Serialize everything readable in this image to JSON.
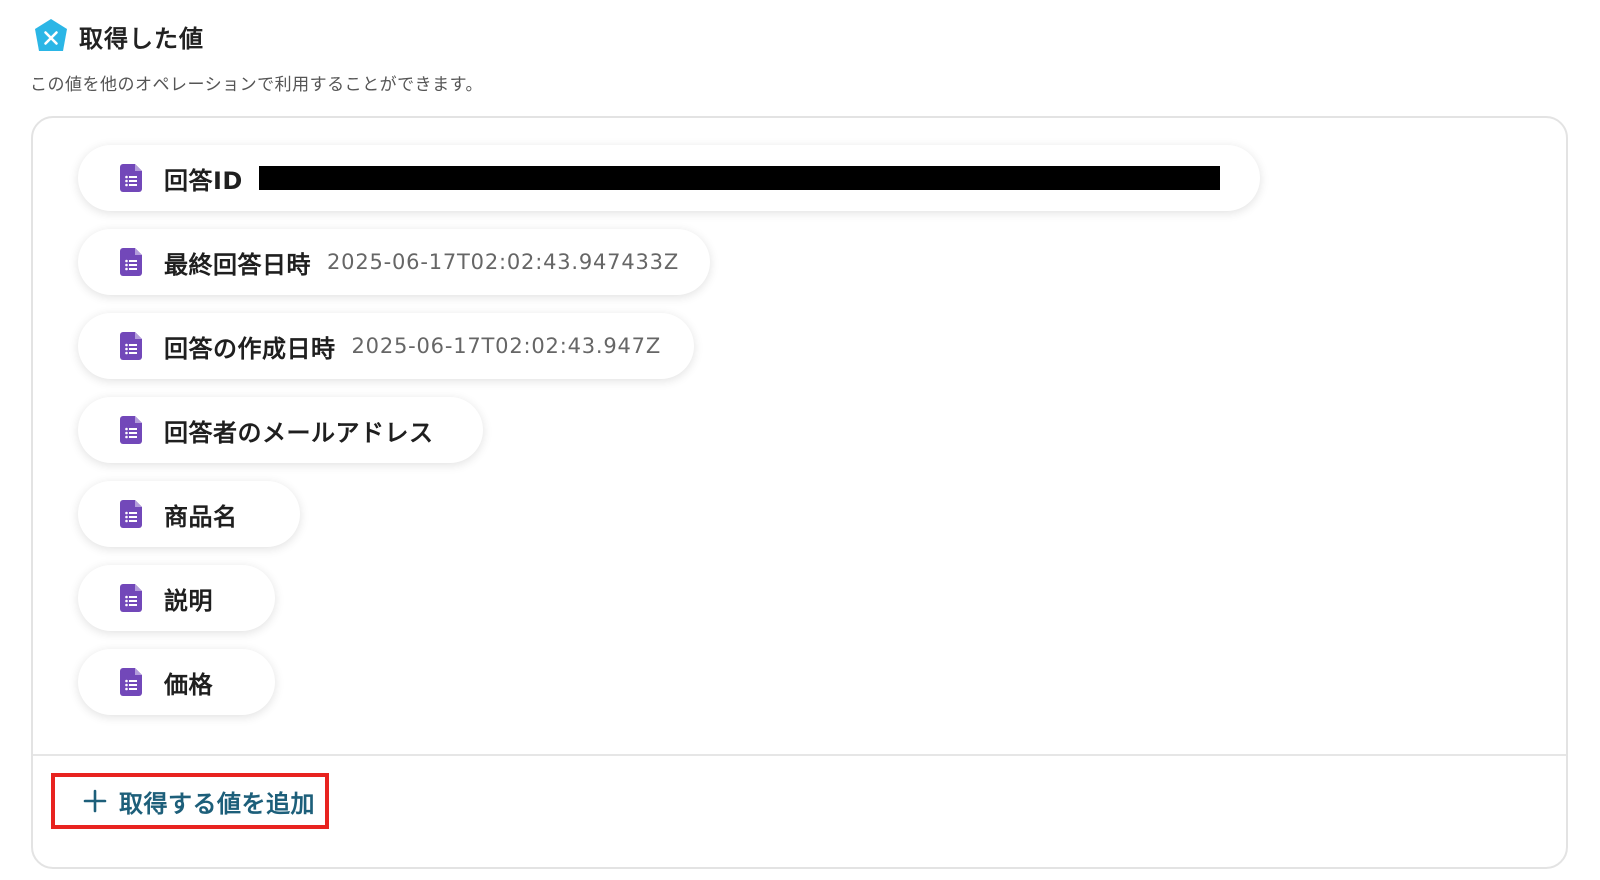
{
  "header": {
    "title": "取得した値",
    "logo_icon": "yoom-hexagon-x-icon",
    "logo_color": "#2bb6e6"
  },
  "subtitle": "この値を他のオペレーションで利用することができます。",
  "fields": [
    {
      "label": "回答ID",
      "value": "",
      "redacted": true,
      "icon": "google-forms-doc-icon"
    },
    {
      "label": "最終回答日時",
      "value": "2025-06-17T02:02:43.947433Z",
      "icon": "google-forms-doc-icon"
    },
    {
      "label": "回答の作成日時",
      "value": "2025-06-17T02:02:43.947Z",
      "icon": "google-forms-doc-icon"
    },
    {
      "label": "回答者のメールアドレス",
      "value": "",
      "icon": "google-forms-doc-icon"
    },
    {
      "label": "商品名",
      "value": "",
      "icon": "google-forms-doc-icon"
    },
    {
      "label": "説明",
      "value": "",
      "icon": "google-forms-doc-icon"
    },
    {
      "label": "価格",
      "value": "",
      "icon": "google-forms-doc-icon"
    }
  ],
  "add_button": {
    "label": "取得する値を追加",
    "icon": "plus-icon",
    "highlight_color": "#e8231f"
  },
  "colors": {
    "doc_icon": "#7248b9",
    "add_text": "#1d5f7a"
  }
}
